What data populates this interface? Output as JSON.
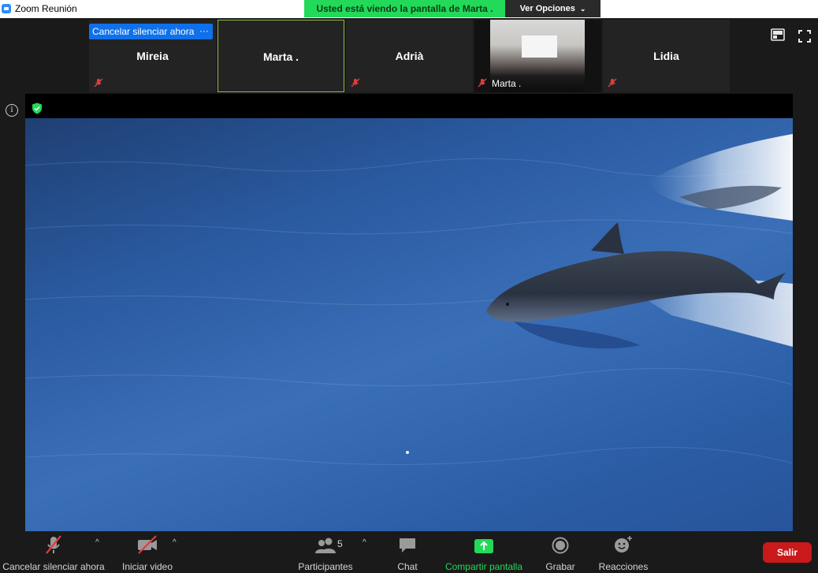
{
  "window": {
    "title": "Zoom Reunión"
  },
  "banner": {
    "message": "Usted está viendo la pantalla de Marta .",
    "options_label": "Ver Opciones"
  },
  "self_controls": {
    "unmute_label": "Cancelar silenciar ahora",
    "more_label": "···"
  },
  "participants": [
    {
      "name": "Mireia",
      "muted": true
    },
    {
      "name": "Marta .",
      "muted": false,
      "active_speaker": true
    },
    {
      "name": "Adrià",
      "muted": true
    },
    {
      "name": "Marta .",
      "muted": true,
      "video": true
    },
    {
      "name": "Lidia",
      "muted": true
    }
  ],
  "toolbar": {
    "audio_label": "Cancelar silenciar ahora",
    "video_label": "Iniciar video",
    "participants_label": "Participantes",
    "participants_count": "5",
    "chat_label": "Chat",
    "share_label": "Compartir pantalla",
    "record_label": "Grabar",
    "reactions_label": "Reacciones",
    "leave_label": "Salir"
  },
  "colors": {
    "share_green": "#23d959",
    "blue": "#0e71eb",
    "leave_red": "#c9191a",
    "active_border": "#8bbf3c"
  }
}
